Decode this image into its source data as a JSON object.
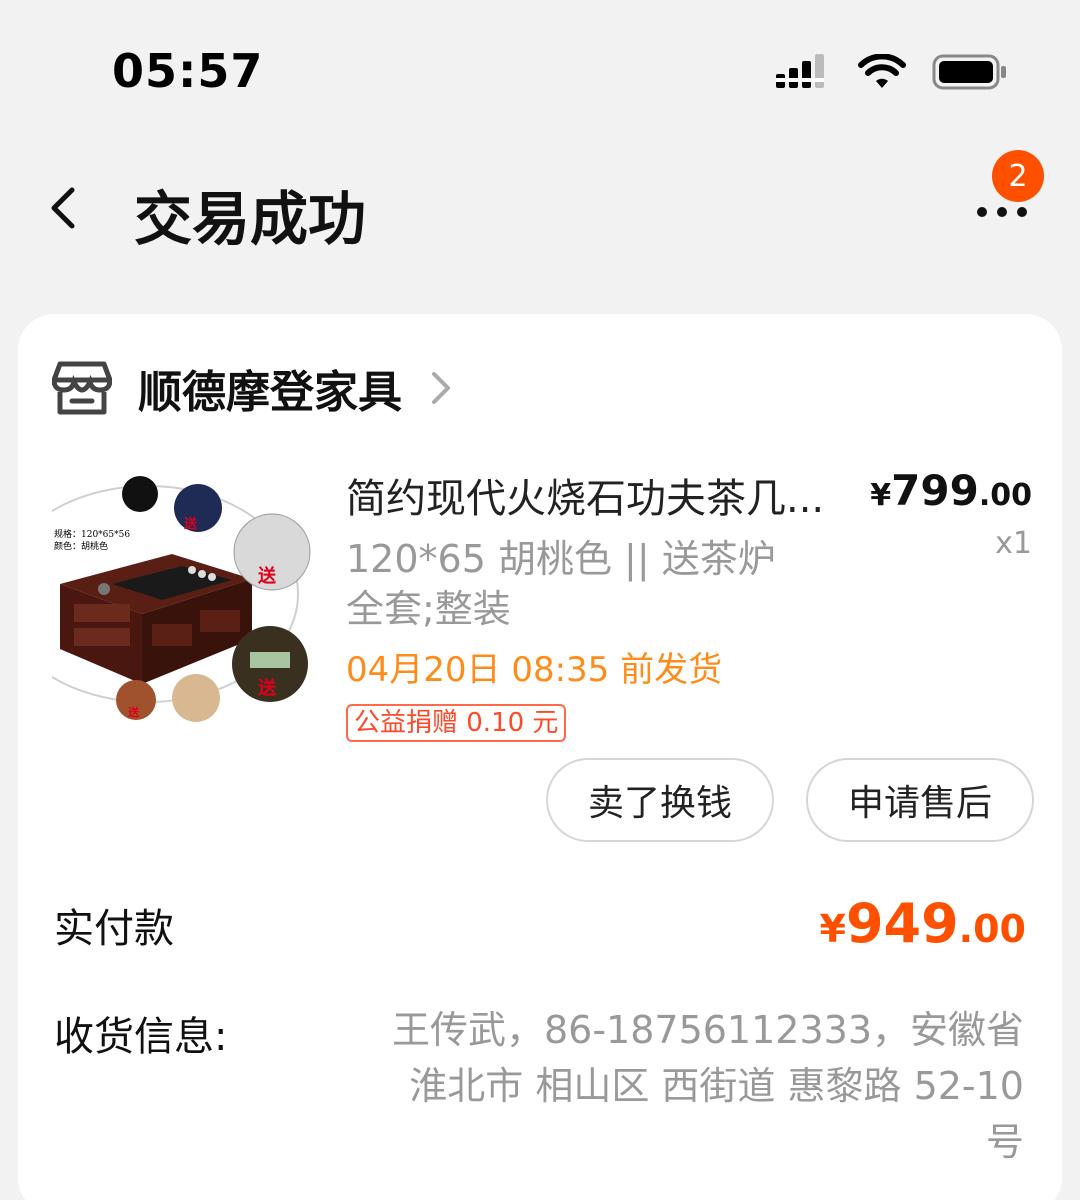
{
  "status_bar": {
    "time": "05:57"
  },
  "nav": {
    "title": "交易成功",
    "badge_count": "2"
  },
  "shop": {
    "name": "顺德摩登家具"
  },
  "product": {
    "title": "简约现代火烧石功夫茶几...",
    "price_currency": "¥",
    "price_integer": "799",
    "price_decimal": ".00",
    "quantity": "x1",
    "spec": "120*65 胡桃色 || 送茶炉 全套;整装",
    "ship_time": "04月20日 08:35 前发货",
    "charity": "公益捐赠 0.10 元",
    "image_labels": {
      "spec_size": "规格：120*65*56",
      "spec_color": "颜色：胡桃色",
      "gift": "送"
    }
  },
  "actions": {
    "sell": "卖了换钱",
    "after_sale": "申请售后"
  },
  "payment": {
    "label": "实付款",
    "currency": "¥",
    "integer": "949",
    "decimal": ".00"
  },
  "address": {
    "label": "收货信息:",
    "value": "王传武，86-18756112333，安徽省 淮北市 相山区 西街道 惠黎路 52-10 号"
  },
  "colors": {
    "accent": "#ff5000",
    "ship_time": "#ff8c1a",
    "muted": "#999999"
  }
}
